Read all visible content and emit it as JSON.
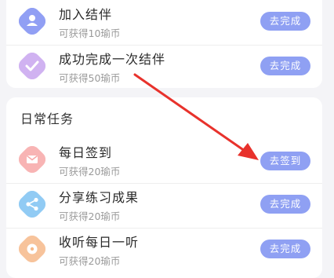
{
  "top_tasks": [
    {
      "title": "加入结伴",
      "reward": "可获得10瑜币",
      "action": "去完成",
      "icon": "user-icon",
      "icon_color": "#7e8ef2"
    },
    {
      "title": "成功完成一次结伴",
      "reward": "可获得50瑜币",
      "action": "去完成",
      "icon": "check-icon",
      "icon_color": "#c8a4ef"
    }
  ],
  "daily": {
    "section_title": "日常任务",
    "tasks": [
      {
        "title": "每日签到",
        "reward": "可获得20瑜币",
        "action": "去签到",
        "icon": "mail-icon",
        "icon_color": "#f7a7a7"
      },
      {
        "title": "分享练习成果",
        "reward": "可获得20瑜币",
        "action": "去完成",
        "icon": "share-icon",
        "icon_color": "#7ec2f2"
      },
      {
        "title": "收听每日一听",
        "reward": "可获得20瑜币",
        "action": "去完成",
        "icon": "play-icon",
        "icon_color": "#f6b98a"
      }
    ]
  },
  "colors": {
    "button": "#8fa0f3",
    "annotation_arrow": "#e8322c"
  }
}
